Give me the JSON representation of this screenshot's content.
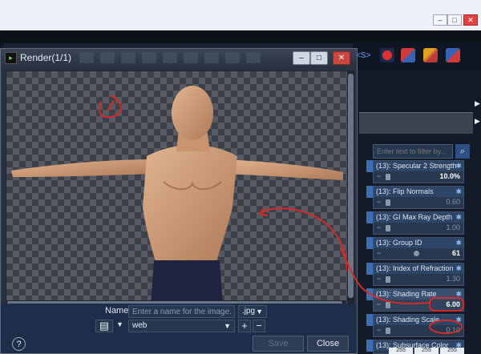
{
  "render_window": {
    "title": "Render(1/1)",
    "name_label": "Name :",
    "name_placeholder": "Enter a name for the image...",
    "format": ".jpg",
    "preset": "web",
    "add": "+",
    "remove": "−",
    "help": "?",
    "save_label": "Save",
    "close_label": "Close"
  },
  "host": {
    "toolbar_text": "<S>",
    "panel_arrow_up": "▶",
    "panel_arrow_down": "▶"
  },
  "panel": {
    "filter_placeholder": "Enter text to filter by...",
    "properties": [
      {
        "label": "(13): Specular 2 Strength",
        "value": "10.0%",
        "bright": true
      },
      {
        "label": "(13): Flip Normals",
        "value": "0.60",
        "bright": false
      },
      {
        "label": "(13): GI Max Ray Depth",
        "value": "1.00",
        "bright": false
      },
      {
        "label": "(13): Group ID",
        "value": "61",
        "bright": true
      },
      {
        "label": "(13): Index of Refraction",
        "value": "1.30",
        "bright": false
      },
      {
        "label": "(13): Shading Rate",
        "value": "6.00",
        "bright": true
      },
      {
        "label": "(13): Shading Scale",
        "value": "0.10",
        "bright": false
      },
      {
        "label": "(13): Subsurface Color",
        "value": "",
        "bright": false
      }
    ],
    "subsurface_values": [
      "255",
      "255",
      "255"
    ]
  },
  "colors": {
    "accent": "#2d4f83",
    "annotation": "#d42a2a",
    "yellow": "#f0c419"
  }
}
